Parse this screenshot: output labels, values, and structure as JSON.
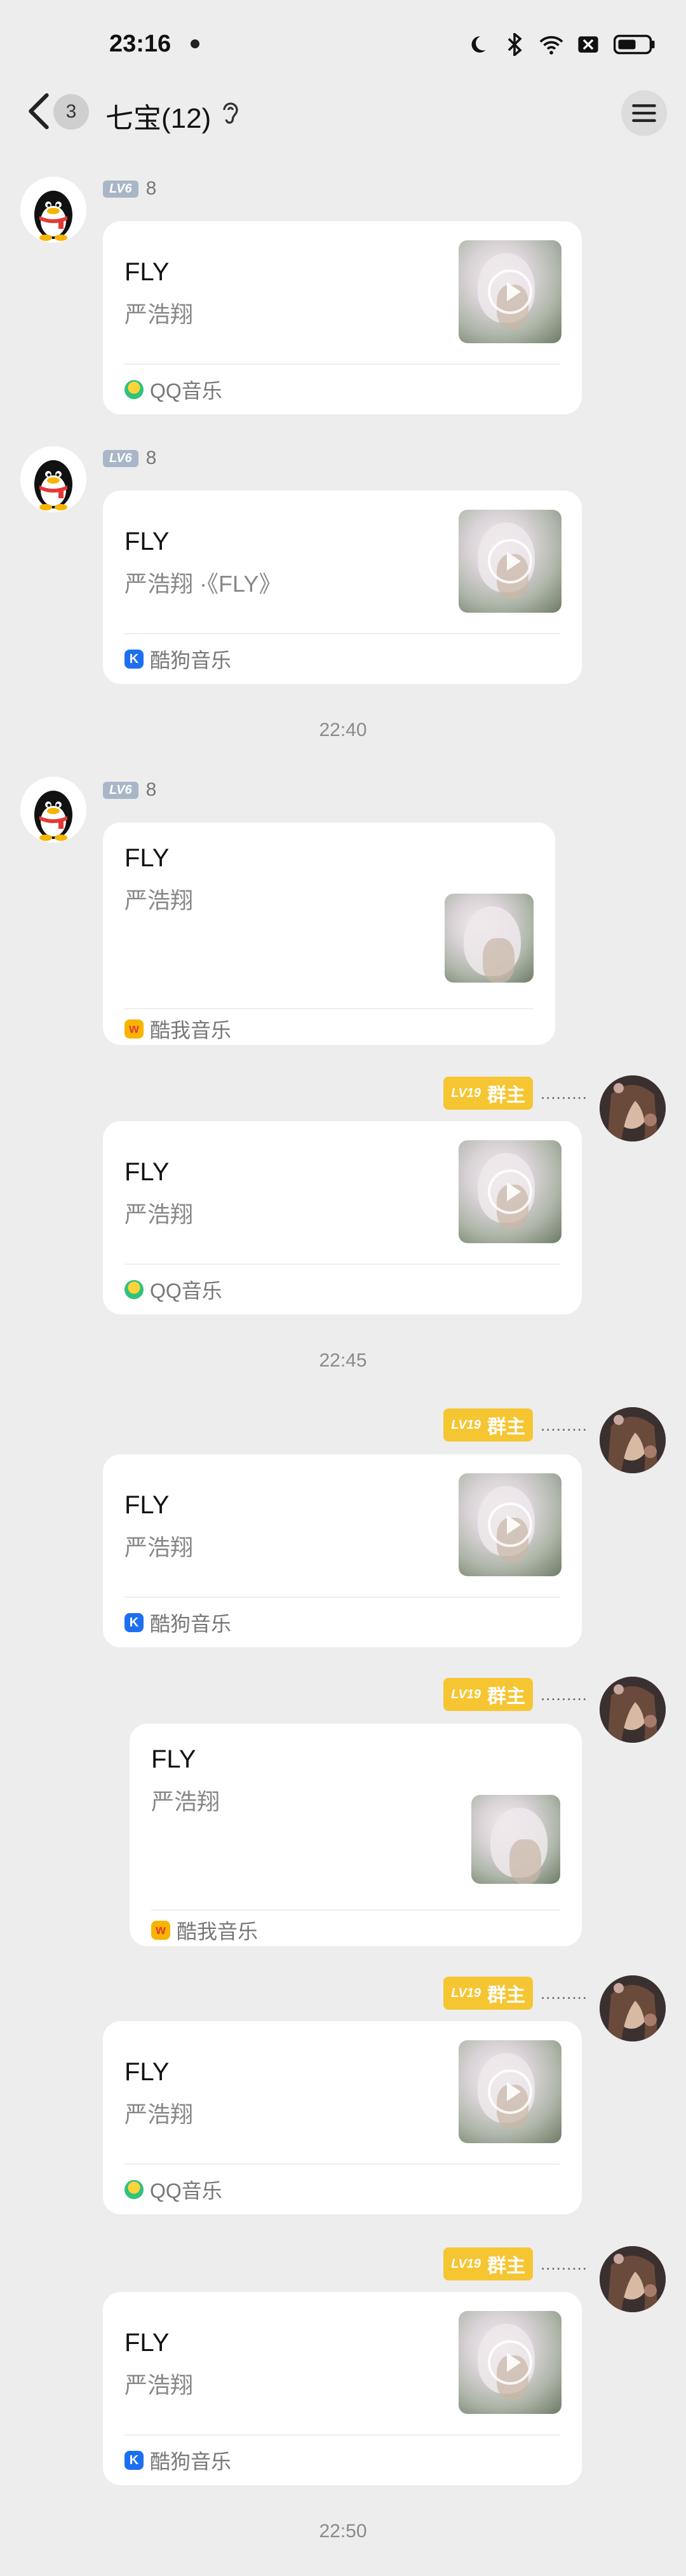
{
  "status_bar": {
    "time": "23:16"
  },
  "header": {
    "unread_count": "3",
    "title": "七宝(12)"
  },
  "timestamps": [
    "22:40",
    "22:45",
    "22:50"
  ],
  "messages": [
    {
      "side": "left",
      "level": "LV6",
      "sender": "8",
      "song": "FLY",
      "artist": "严浩翔",
      "source": "QQ音乐",
      "source_type": "qq"
    },
    {
      "side": "left",
      "level": "LV6",
      "sender": "8",
      "song": "FLY",
      "artist": "严浩翔 ·《FLY》",
      "source": "酷狗音乐",
      "source_type": "kugou"
    },
    {
      "side": "left",
      "level": "LV6",
      "sender": "8",
      "song": "FLY",
      "artist": "严浩翔",
      "source": "酷我音乐",
      "source_type": "kuwo"
    },
    {
      "side": "right",
      "level": "LV19",
      "role": "群主",
      "sender": ".........",
      "song": "FLY",
      "artist": "严浩翔",
      "source": "QQ音乐",
      "source_type": "qq"
    },
    {
      "side": "right",
      "level": "LV19",
      "role": "群主",
      "sender": ".........",
      "song": "FLY",
      "artist": "严浩翔",
      "source": "酷狗音乐",
      "source_type": "kugou"
    },
    {
      "side": "right",
      "level": "LV19",
      "role": "群主",
      "sender": ".........",
      "song": "FLY",
      "artist": "严浩翔",
      "source": "酷我音乐",
      "source_type": "kuwo"
    },
    {
      "side": "right",
      "level": "LV19",
      "role": "群主",
      "sender": ".........",
      "song": "FLY",
      "artist": "严浩翔",
      "source": "QQ音乐",
      "source_type": "qq"
    },
    {
      "side": "right",
      "level": "LV19",
      "role": "群主",
      "sender": ".........",
      "song": "FLY",
      "artist": "严浩翔",
      "source": "酷狗音乐",
      "source_type": "kugou"
    }
  ],
  "source_icons": {
    "kugou": "K",
    "kuwo": "w"
  },
  "colors": {
    "background": "#ededed",
    "owner_badge": "#f6c532",
    "level_badge": "#a9b6c7",
    "kugou": "#1d6ff2"
  }
}
